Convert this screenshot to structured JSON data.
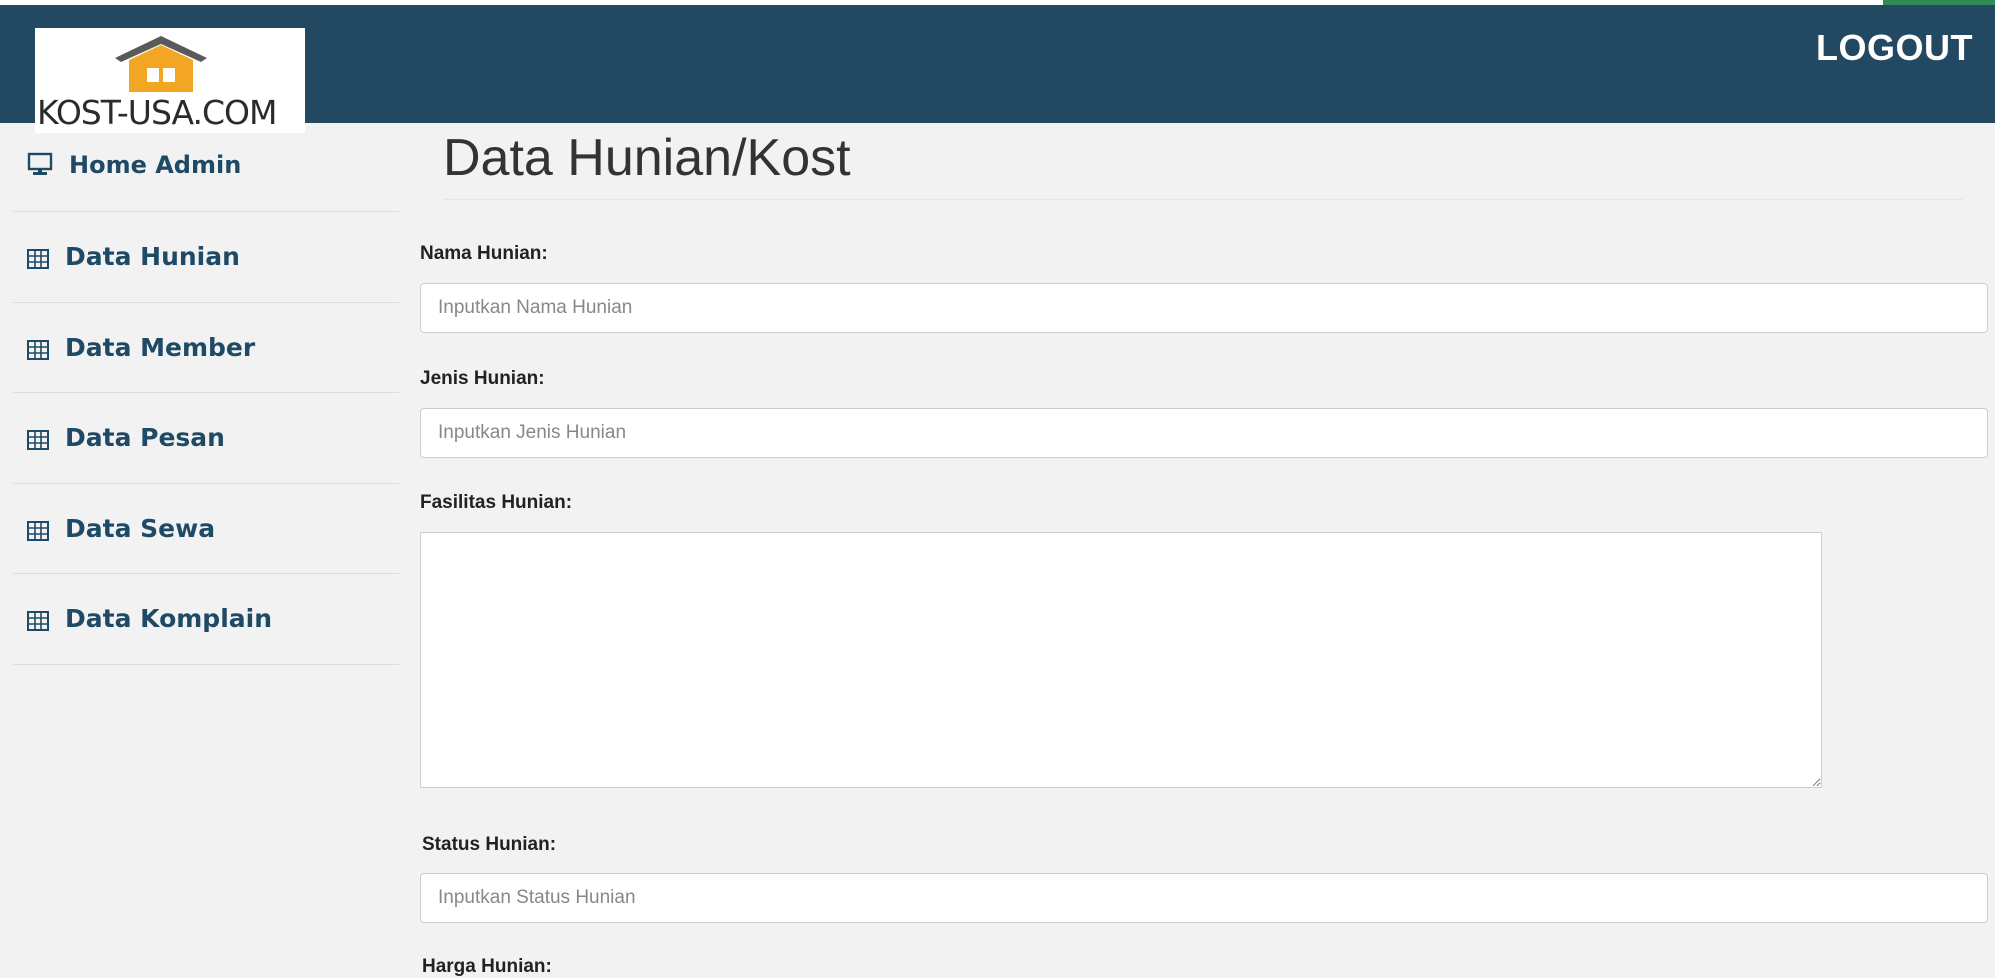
{
  "header": {
    "logo_text": "KOST-USA.COM",
    "logout_label": "LOGOUT",
    "bg_color": "#234962"
  },
  "sidebar": {
    "items": [
      {
        "label": "Home Admin",
        "icon": "monitor-icon"
      },
      {
        "label": "Data Hunian",
        "icon": "table-icon"
      },
      {
        "label": "Data Member",
        "icon": "table-icon"
      },
      {
        "label": "Data Pesan",
        "icon": "table-icon"
      },
      {
        "label": "Data Sewa",
        "icon": "table-icon"
      },
      {
        "label": "Data Komplain",
        "icon": "table-icon"
      }
    ],
    "text_color": "#1f4a66"
  },
  "main": {
    "title": "Data Hunian/Kost",
    "fields": {
      "nama": {
        "label": "Nama Hunian:",
        "placeholder": "Inputkan Nama Hunian",
        "value": ""
      },
      "jenis": {
        "label": "Jenis Hunian:",
        "placeholder": "Inputkan Jenis Hunian",
        "value": ""
      },
      "fasilitas": {
        "label": "Fasilitas Hunian:",
        "value": ""
      },
      "status": {
        "label": "Status Hunian:",
        "placeholder": "Inputkan Status Hunian",
        "value": ""
      },
      "harga": {
        "label": "Harga Hunian:"
      }
    }
  }
}
